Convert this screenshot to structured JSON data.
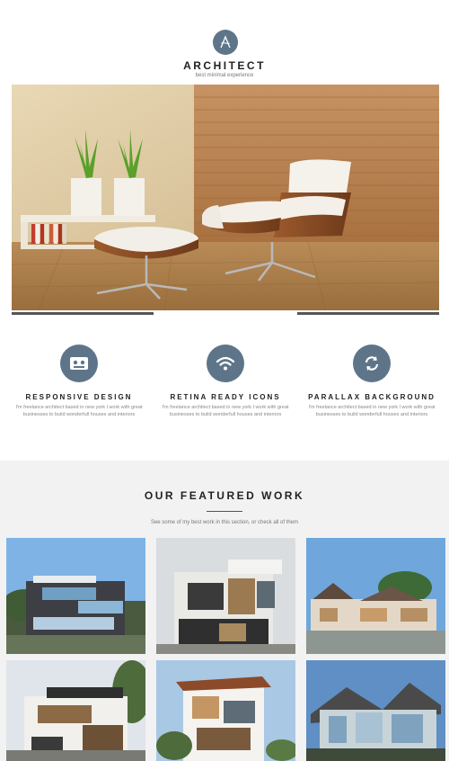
{
  "header": {
    "logo_letter": "A",
    "title": "ARCHITECT",
    "tagline": "best minimal experience"
  },
  "hero": {
    "slides_total": 3,
    "active_slide": 2
  },
  "features": [
    {
      "icon": "cassette-icon",
      "title": "RESPONSIVE DESIGN",
      "text": "I'm freelance architect based in new york I work with great businesses to build wonderfull houses and interiors"
    },
    {
      "icon": "wifi-icon",
      "title": "RETINA READY ICONS",
      "text": "I'm freelance architect based in new york I work with great businesses to build wonderfull houses and interiors"
    },
    {
      "icon": "refresh-icon",
      "title": "PARALLAX BACKGROUND",
      "text": "I'm freelance architect based in new york I work with great businesses to build wonderfull houses and interiors"
    }
  ],
  "featured": {
    "title": "OUR FEATURED WORK",
    "subtitle": "See some of my best work in this section, or check all of them"
  },
  "colors": {
    "accent": "#5e7589",
    "section_bg": "#f2f2f2",
    "bar_active": "#555555",
    "bar_inactive": "#dddddd"
  }
}
